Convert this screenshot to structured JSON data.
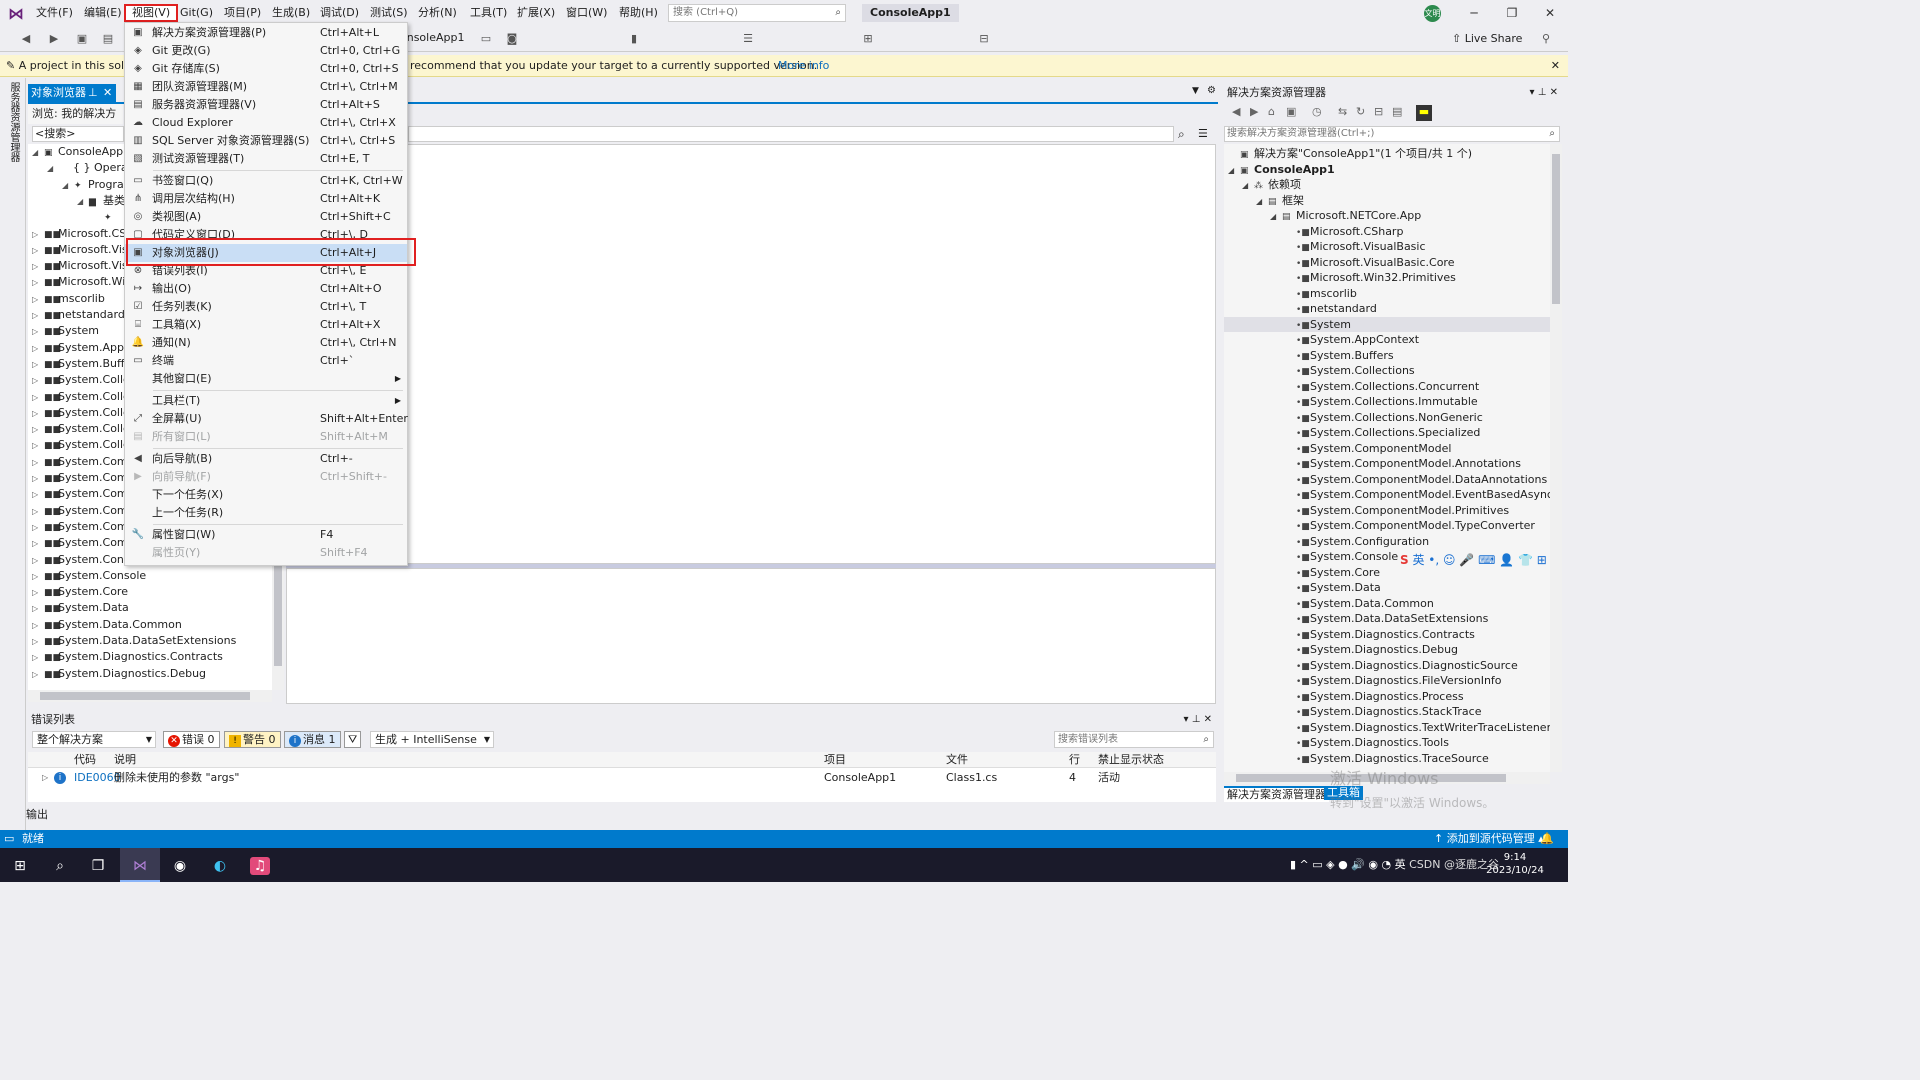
{
  "menubar": {
    "items": [
      "文件(F)",
      "编辑(E)",
      "视图(V)",
      "Git(G)",
      "项目(P)",
      "生成(B)",
      "调试(D)",
      "测试(S)",
      "分析(N)",
      "工具(T)",
      "扩展(X)",
      "窗口(W)",
      "帮助(H)"
    ],
    "search_placeholder": "搜索 (Ctrl+Q)",
    "app_title": "ConsoleApp1",
    "avatar_text": "文明"
  },
  "toolbar": {
    "config": "onsoleApp1",
    "live_share": "Live Share"
  },
  "infobar": {
    "text_left": "A project in this solut",
    "text_right": "recommend that you update your target to a currently supported version.",
    "link": "More info"
  },
  "left_strip": {
    "label": "服务器资源管理器"
  },
  "object_browser": {
    "tab_title": "对象浏览器",
    "browse_label": "浏览: 我的解决方案",
    "search_value": "<搜索>",
    "tree": [
      {
        "label": "ConsoleApp1",
        "arrow": "◢",
        "icon": "▣",
        "indent": 0
      },
      {
        "label": "{ } Operators",
        "arrow": "◢",
        "icon": "",
        "indent": 1
      },
      {
        "label": "Progra",
        "arrow": "◢",
        "icon": "✦",
        "indent": 2
      },
      {
        "label": "基类",
        "arrow": "◢",
        "icon": "▆",
        "indent": 3
      },
      {
        "label": "",
        "arrow": "",
        "icon": "✦",
        "indent": 4
      },
      {
        "label": "Microsoft.CSh",
        "arrow": "▷",
        "icon": "■■",
        "indent": 0
      },
      {
        "label": "Microsoft.Visu",
        "arrow": "▷",
        "icon": "■■",
        "indent": 0
      },
      {
        "label": "Microsoft.Visu",
        "arrow": "▷",
        "icon": "■■",
        "indent": 0
      },
      {
        "label": "Microsoft.Win",
        "arrow": "▷",
        "icon": "■■",
        "indent": 0
      },
      {
        "label": "mscorlib",
        "arrow": "▷",
        "icon": "■■",
        "indent": 0
      },
      {
        "label": "netstandard",
        "arrow": "▷",
        "icon": "■■",
        "indent": 0
      },
      {
        "label": "System",
        "arrow": "▷",
        "icon": "■■",
        "indent": 0
      },
      {
        "label": "System.AppCo",
        "arrow": "▷",
        "icon": "■■",
        "indent": 0
      },
      {
        "label": "System.Buffer",
        "arrow": "▷",
        "icon": "■■",
        "indent": 0
      },
      {
        "label": "System.Collec",
        "arrow": "▷",
        "icon": "■■",
        "indent": 0
      },
      {
        "label": "System.Collec",
        "arrow": "▷",
        "icon": "■■",
        "indent": 0
      },
      {
        "label": "System.Collec",
        "arrow": "▷",
        "icon": "■■",
        "indent": 0
      },
      {
        "label": "System.Collec",
        "arrow": "▷",
        "icon": "■■",
        "indent": 0
      },
      {
        "label": "System.Collec",
        "arrow": "▷",
        "icon": "■■",
        "indent": 0
      },
      {
        "label": "System.Comp",
        "arrow": "▷",
        "icon": "■■",
        "indent": 0
      },
      {
        "label": "System.Comp",
        "arrow": "▷",
        "icon": "■■",
        "indent": 0
      },
      {
        "label": "System.Comp",
        "arrow": "▷",
        "icon": "■■",
        "indent": 0
      },
      {
        "label": "System.Comp",
        "arrow": "▷",
        "icon": "■■",
        "indent": 0
      },
      {
        "label": "System.Comp",
        "arrow": "▷",
        "icon": "■■",
        "indent": 0
      },
      {
        "label": "System.Comp",
        "arrow": "▷",
        "icon": "■■",
        "indent": 0
      },
      {
        "label": "System.Config",
        "arrow": "▷",
        "icon": "■■",
        "indent": 0
      },
      {
        "label": "System.Console",
        "arrow": "▷",
        "icon": "■■",
        "indent": 0
      },
      {
        "label": "System.Core",
        "arrow": "▷",
        "icon": "■■",
        "indent": 0
      },
      {
        "label": "System.Data",
        "arrow": "▷",
        "icon": "■■",
        "indent": 0
      },
      {
        "label": "System.Data.Common",
        "arrow": "▷",
        "icon": "■■",
        "indent": 0
      },
      {
        "label": "System.Data.DataSetExtensions",
        "arrow": "▷",
        "icon": "■■",
        "indent": 0
      },
      {
        "label": "System.Diagnostics.Contracts",
        "arrow": "▷",
        "icon": "■■",
        "indent": 0
      },
      {
        "label": "System.Diagnostics.Debug",
        "arrow": "▷",
        "icon": "■■",
        "indent": 0
      }
    ]
  },
  "view_menu": {
    "items": [
      {
        "type": "item",
        "icon": "▣",
        "label": "解决方案资源管理器(P)",
        "shortcut": "Ctrl+Alt+L"
      },
      {
        "type": "item",
        "icon": "◈",
        "label": "Git 更改(G)",
        "shortcut": "Ctrl+0, Ctrl+G"
      },
      {
        "type": "item",
        "icon": "◈",
        "label": "Git 存储库(S)",
        "shortcut": "Ctrl+0, Ctrl+S"
      },
      {
        "type": "item",
        "icon": "▦",
        "label": "团队资源管理器(M)",
        "shortcut": "Ctrl+\\, Ctrl+M"
      },
      {
        "type": "item",
        "icon": "▤",
        "label": "服务器资源管理器(V)",
        "shortcut": "Ctrl+Alt+S"
      },
      {
        "type": "item",
        "icon": "☁",
        "label": "Cloud Explorer",
        "shortcut": "Ctrl+\\, Ctrl+X"
      },
      {
        "type": "item",
        "icon": "▥",
        "label": "SQL Server 对象资源管理器(S)",
        "shortcut": "Ctrl+\\, Ctrl+S"
      },
      {
        "type": "item",
        "icon": "▧",
        "label": "测试资源管理器(T)",
        "shortcut": "Ctrl+E, T"
      },
      {
        "type": "sep"
      },
      {
        "type": "item",
        "icon": "▭",
        "label": "书签窗口(Q)",
        "shortcut": "Ctrl+K, Ctrl+W"
      },
      {
        "type": "item",
        "icon": "⋔",
        "label": "调用层次结构(H)",
        "shortcut": "Ctrl+Alt+K"
      },
      {
        "type": "item",
        "icon": "◎",
        "label": "类视图(A)",
        "shortcut": "Ctrl+Shift+C"
      },
      {
        "type": "item",
        "icon": "▢",
        "label": "代码定义窗口(D)",
        "shortcut": "Ctrl+\\, D"
      },
      {
        "type": "item",
        "icon": "▣",
        "label": "对象浏览器(J)",
        "shortcut": "Ctrl+Alt+J",
        "highlight": true
      },
      {
        "type": "item",
        "icon": "⊗",
        "label": "错误列表(I)",
        "shortcut": "Ctrl+\\, E"
      },
      {
        "type": "item",
        "icon": "↦",
        "label": "输出(O)",
        "shortcut": "Ctrl+Alt+O"
      },
      {
        "type": "item",
        "icon": "☑",
        "label": "任务列表(K)",
        "shortcut": "Ctrl+\\, T"
      },
      {
        "type": "item",
        "icon": "⌸",
        "label": "工具箱(X)",
        "shortcut": "Ctrl+Alt+X"
      },
      {
        "type": "item",
        "icon": "🔔",
        "label": "通知(N)",
        "shortcut": "Ctrl+\\, Ctrl+N"
      },
      {
        "type": "item",
        "icon": "▭",
        "label": "终端",
        "shortcut": "Ctrl+`"
      },
      {
        "type": "item",
        "icon": "",
        "label": "其他窗口(E)",
        "shortcut": "",
        "submenu": true
      },
      {
        "type": "sep"
      },
      {
        "type": "item",
        "icon": "",
        "label": "工具栏(T)",
        "shortcut": "",
        "submenu": true
      },
      {
        "type": "item",
        "icon": "⤢",
        "label": "全屏幕(U)",
        "shortcut": "Shift+Alt+Enter"
      },
      {
        "type": "item",
        "icon": "▤",
        "label": "所有窗口(L)",
        "shortcut": "Shift+Alt+M",
        "disabled": true
      },
      {
        "type": "sep"
      },
      {
        "type": "item",
        "icon": "◀",
        "label": "向后导航(B)",
        "shortcut": "Ctrl+-"
      },
      {
        "type": "item",
        "icon": "▶",
        "label": "向前导航(F)",
        "shortcut": "Ctrl+Shift+-",
        "disabled": true
      },
      {
        "type": "item",
        "icon": "",
        "label": "下一个任务(X)",
        "shortcut": ""
      },
      {
        "type": "item",
        "icon": "",
        "label": "上一个任务(R)",
        "shortcut": ""
      },
      {
        "type": "sep"
      },
      {
        "type": "item",
        "icon": "🔧",
        "label": "属性窗口(W)",
        "shortcut": "F4"
      },
      {
        "type": "item",
        "icon": "",
        "label": "属性页(Y)",
        "shortcut": "Shift+F4",
        "disabled": true
      }
    ]
  },
  "solution_explorer": {
    "title": "解决方案资源管理器",
    "search_placeholder": "搜索解决方案资源管理器(Ctrl+;)",
    "tree": [
      {
        "label": "解决方案\"ConsoleApp1\"(1 个项目/共 1 个)",
        "arrow": "",
        "icon": "▣",
        "indent": 0
      },
      {
        "label": "ConsoleApp1",
        "arrow": "◢",
        "icon": "▣",
        "indent": 0,
        "bold": true
      },
      {
        "label": "依赖项",
        "arrow": "◢",
        "icon": "⁂",
        "indent": 1
      },
      {
        "label": "框架",
        "arrow": "◢",
        "icon": "▤",
        "indent": 2
      },
      {
        "label": "Microsoft.NETCore.App",
        "arrow": "◢",
        "icon": "▤",
        "indent": 3
      },
      {
        "label": "Microsoft.CSharp",
        "arrow": "",
        "icon": "•■",
        "indent": 4
      },
      {
        "label": "Microsoft.VisualBasic",
        "arrow": "",
        "icon": "•■",
        "indent": 4
      },
      {
        "label": "Microsoft.VisualBasic.Core",
        "arrow": "",
        "icon": "•■",
        "indent": 4
      },
      {
        "label": "Microsoft.Win32.Primitives",
        "arrow": "",
        "icon": "•■",
        "indent": 4
      },
      {
        "label": "mscorlib",
        "arrow": "",
        "icon": "•■",
        "indent": 4
      },
      {
        "label": "netstandard",
        "arrow": "",
        "icon": "•■",
        "indent": 4
      },
      {
        "label": "System",
        "arrow": "",
        "icon": "•■",
        "indent": 4,
        "sel": true
      },
      {
        "label": "System.AppContext",
        "arrow": "",
        "icon": "•■",
        "indent": 4
      },
      {
        "label": "System.Buffers",
        "arrow": "",
        "icon": "•■",
        "indent": 4
      },
      {
        "label": "System.Collections",
        "arrow": "",
        "icon": "•■",
        "indent": 4
      },
      {
        "label": "System.Collections.Concurrent",
        "arrow": "",
        "icon": "•■",
        "indent": 4
      },
      {
        "label": "System.Collections.Immutable",
        "arrow": "",
        "icon": "•■",
        "indent": 4
      },
      {
        "label": "System.Collections.NonGeneric",
        "arrow": "",
        "icon": "•■",
        "indent": 4
      },
      {
        "label": "System.Collections.Specialized",
        "arrow": "",
        "icon": "•■",
        "indent": 4
      },
      {
        "label": "System.ComponentModel",
        "arrow": "",
        "icon": "•■",
        "indent": 4
      },
      {
        "label": "System.ComponentModel.Annotations",
        "arrow": "",
        "icon": "•■",
        "indent": 4
      },
      {
        "label": "System.ComponentModel.DataAnnotations",
        "arrow": "",
        "icon": "•■",
        "indent": 4
      },
      {
        "label": "System.ComponentModel.EventBasedAsync",
        "arrow": "",
        "icon": "•■",
        "indent": 4
      },
      {
        "label": "System.ComponentModel.Primitives",
        "arrow": "",
        "icon": "•■",
        "indent": 4
      },
      {
        "label": "System.ComponentModel.TypeConverter",
        "arrow": "",
        "icon": "•■",
        "indent": 4
      },
      {
        "label": "System.Configuration",
        "arrow": "",
        "icon": "•■",
        "indent": 4
      },
      {
        "label": "System.Console",
        "arrow": "",
        "icon": "•■",
        "indent": 4
      },
      {
        "label": "System.Core",
        "arrow": "",
        "icon": "•■",
        "indent": 4
      },
      {
        "label": "System.Data",
        "arrow": "",
        "icon": "•■",
        "indent": 4
      },
      {
        "label": "System.Data.Common",
        "arrow": "",
        "icon": "•■",
        "indent": 4
      },
      {
        "label": "System.Data.DataSetExtensions",
        "arrow": "",
        "icon": "•■",
        "indent": 4
      },
      {
        "label": "System.Diagnostics.Contracts",
        "arrow": "",
        "icon": "•■",
        "indent": 4
      },
      {
        "label": "System.Diagnostics.Debug",
        "arrow": "",
        "icon": "•■",
        "indent": 4
      },
      {
        "label": "System.Diagnostics.DiagnosticSource",
        "arrow": "",
        "icon": "•■",
        "indent": 4
      },
      {
        "label": "System.Diagnostics.FileVersionInfo",
        "arrow": "",
        "icon": "•■",
        "indent": 4
      },
      {
        "label": "System.Diagnostics.Process",
        "arrow": "",
        "icon": "•■",
        "indent": 4
      },
      {
        "label": "System.Diagnostics.StackTrace",
        "arrow": "",
        "icon": "•■",
        "indent": 4
      },
      {
        "label": "System.Diagnostics.TextWriterTraceListener",
        "arrow": "",
        "icon": "•■",
        "indent": 4
      },
      {
        "label": "System.Diagnostics.Tools",
        "arrow": "",
        "icon": "•■",
        "indent": 4
      },
      {
        "label": "System.Diagnostics.TraceSource",
        "arrow": "",
        "icon": "•■",
        "indent": 4
      }
    ],
    "tab_active": "解决方案资源管理器",
    "tab_other": "工具箱"
  },
  "ime": {
    "text": "英 •, ☺ 🎤 ⌨ 👤 👕 ⊞"
  },
  "watermark": {
    "line1": "激活 Windows",
    "line2": "转到\"设置\"以激活 Windows。"
  },
  "error_list": {
    "title": "错误列表",
    "scope": "整个解决方案",
    "errors": "错误 0",
    "warnings": "警告 0",
    "messages": "消息 1",
    "build_filter": "生成 + IntelliSense",
    "search_placeholder": "搜索错误列表",
    "columns": [
      "代码",
      "说明",
      "项目",
      "文件",
      "行",
      "禁止显示状态"
    ],
    "rows": [
      {
        "code": "IDE0060",
        "desc": "删除未使用的参数 \"args\"",
        "project": "ConsoleApp1",
        "file": "Class1.cs",
        "line": "4",
        "state": "活动"
      }
    ]
  },
  "output_tab": "输出",
  "status": {
    "left": "就绪",
    "right": "添加到源代码管理"
  },
  "taskbar": {
    "time": "9:14",
    "date": "2023/10/24",
    "tray": "英",
    "watermark": "CSDN @逐鹿之谷"
  },
  "colors": {
    "accent": "#007acc",
    "highlight_box": "#e02020",
    "info_bg": "#fcf6d0"
  }
}
